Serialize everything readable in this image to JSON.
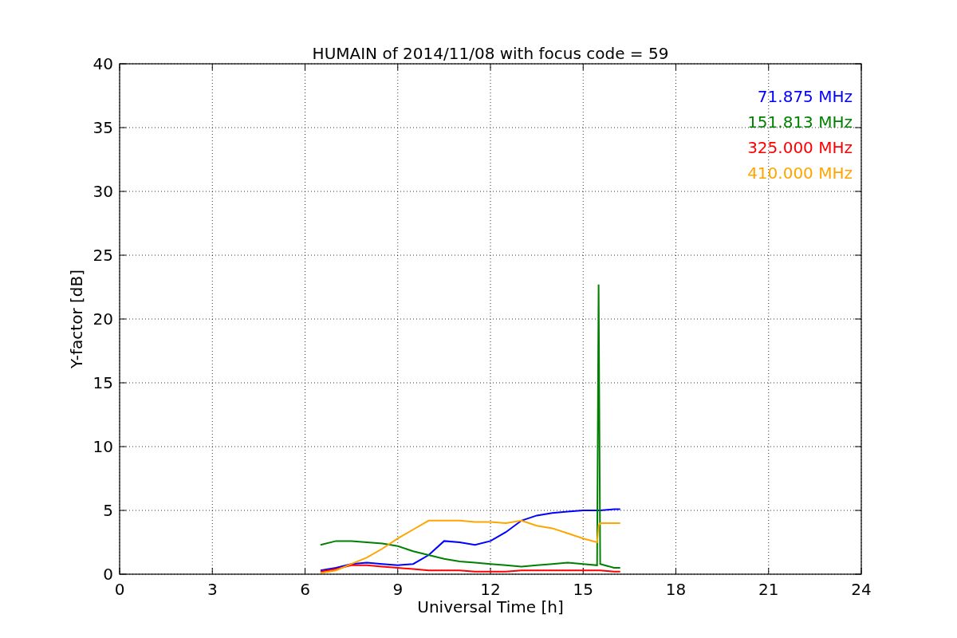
{
  "chart_data": {
    "type": "line",
    "title": "HUMAIN of 2014/11/08 with focus code = 59",
    "xlabel": "Universal Time [h]",
    "ylabel": "Y-factor [dB]",
    "x": [
      6.5,
      7,
      7.5,
      8,
      8.5,
      9,
      9.5,
      10,
      10.5,
      11,
      11.5,
      12,
      12.5,
      13,
      13.5,
      14,
      14.5,
      15,
      15.45,
      15.5,
      15.55,
      16,
      16.2
    ],
    "series": [
      {
        "name": "71.875 MHz",
        "color": "#0000ff",
        "values": [
          0.3,
          0.5,
          0.8,
          0.9,
          0.8,
          0.7,
          0.8,
          1.5,
          2.6,
          2.5,
          2.3,
          2.6,
          3.3,
          4.2,
          4.6,
          4.8,
          4.9,
          5.0,
          5.0,
          5.0,
          5.0,
          5.1,
          5.1
        ]
      },
      {
        "name": "151.813 MHz",
        "color": "#008000",
        "values": [
          2.3,
          2.6,
          2.6,
          2.5,
          2.4,
          2.2,
          1.8,
          1.5,
          1.2,
          1.0,
          0.9,
          0.8,
          0.7,
          0.6,
          0.7,
          0.8,
          0.9,
          0.8,
          0.7,
          22.7,
          0.8,
          0.5,
          0.5
        ]
      },
      {
        "name": "325.000 MHz",
        "color": "#ff0000",
        "values": [
          0.2,
          0.4,
          0.7,
          0.7,
          0.6,
          0.5,
          0.4,
          0.3,
          0.3,
          0.3,
          0.2,
          0.2,
          0.2,
          0.3,
          0.3,
          0.3,
          0.3,
          0.3,
          0.3,
          0.3,
          0.3,
          0.2,
          0.2
        ]
      },
      {
        "name": "410.000 MHz",
        "color": "#ffa500",
        "values": [
          0.1,
          0.3,
          0.8,
          1.3,
          2.0,
          2.8,
          3.5,
          4.2,
          4.2,
          4.2,
          4.1,
          4.1,
          4.0,
          4.2,
          3.8,
          3.6,
          3.2,
          2.8,
          2.5,
          3.8,
          4.0,
          4.0,
          4.0
        ]
      }
    ],
    "grid": true,
    "xlim": [
      0,
      24
    ],
    "ylim": [
      0,
      40
    ],
    "xticks": [
      0,
      3,
      6,
      9,
      12,
      15,
      18,
      21,
      24
    ],
    "yticks": [
      0,
      5,
      10,
      15,
      20,
      25,
      30,
      35,
      40
    ]
  }
}
